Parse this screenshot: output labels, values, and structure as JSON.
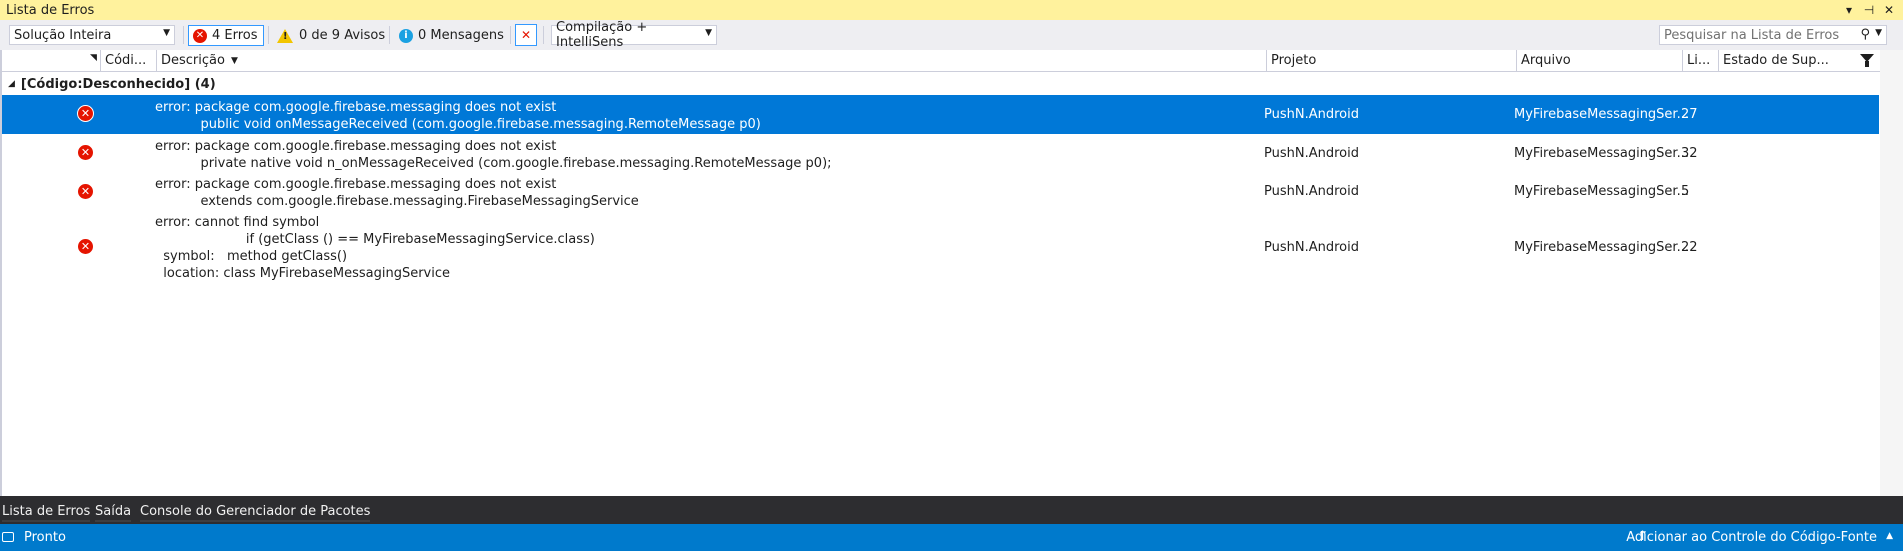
{
  "window": {
    "title": "Lista de Erros",
    "icons": [
      "chevron-down-icon",
      "pin-icon",
      "close-icon"
    ]
  },
  "toolbar": {
    "scope": "Solução Inteira",
    "errors": "4 Erros",
    "warnings": "0 de 9 Avisos",
    "messages": "0 Mensagens",
    "build": "Compilação + IntelliSens",
    "search_placeholder": "Pesquisar na Lista de Erros"
  },
  "columns": {
    "code": "Códi...",
    "desc": "Descrição",
    "project": "Projeto",
    "file": "Arquivo",
    "line": "Li...",
    "state": "Estado de Sup..."
  },
  "group": {
    "label": "[Código:Desconhecido]  (4)"
  },
  "rows": [
    {
      "desc": "error: package com.google.firebase.messaging does not exist\n           public void onMessageReceived (com.google.firebase.messaging.RemoteMessage p0)",
      "project": "PushN.Android",
      "file": "MyFirebaseMessagingSer...",
      "line": "27"
    },
    {
      "desc": "error: package com.google.firebase.messaging does not exist\n           private native void n_onMessageReceived (com.google.firebase.messaging.RemoteMessage p0);",
      "project": "PushN.Android",
      "file": "MyFirebaseMessagingSer...",
      "line": "32"
    },
    {
      "desc": "error: package com.google.firebase.messaging does not exist\n           extends com.google.firebase.messaging.FirebaseMessagingService",
      "project": "PushN.Android",
      "file": "MyFirebaseMessagingSer...",
      "line": "5"
    },
    {
      "desc": "error: cannot find symbol\n                      if (getClass () == MyFirebaseMessagingService.class)\n  symbol:   method getClass()\n  location: class MyFirebaseMessagingService",
      "project": "PushN.Android",
      "file": "MyFirebaseMessagingSer...",
      "line": "22"
    }
  ],
  "tabs": [
    "Lista de Erros",
    "Saída",
    "Console do Gerenciador de Pacotes"
  ],
  "status": {
    "ready": "Pronto",
    "source_control": "Adicionar ao Controle do Código-Fonte"
  },
  "colors": {
    "selection": "#0078d7",
    "statusbar": "#007acc",
    "titlebar": "#fff29d",
    "error": "#e51400"
  }
}
